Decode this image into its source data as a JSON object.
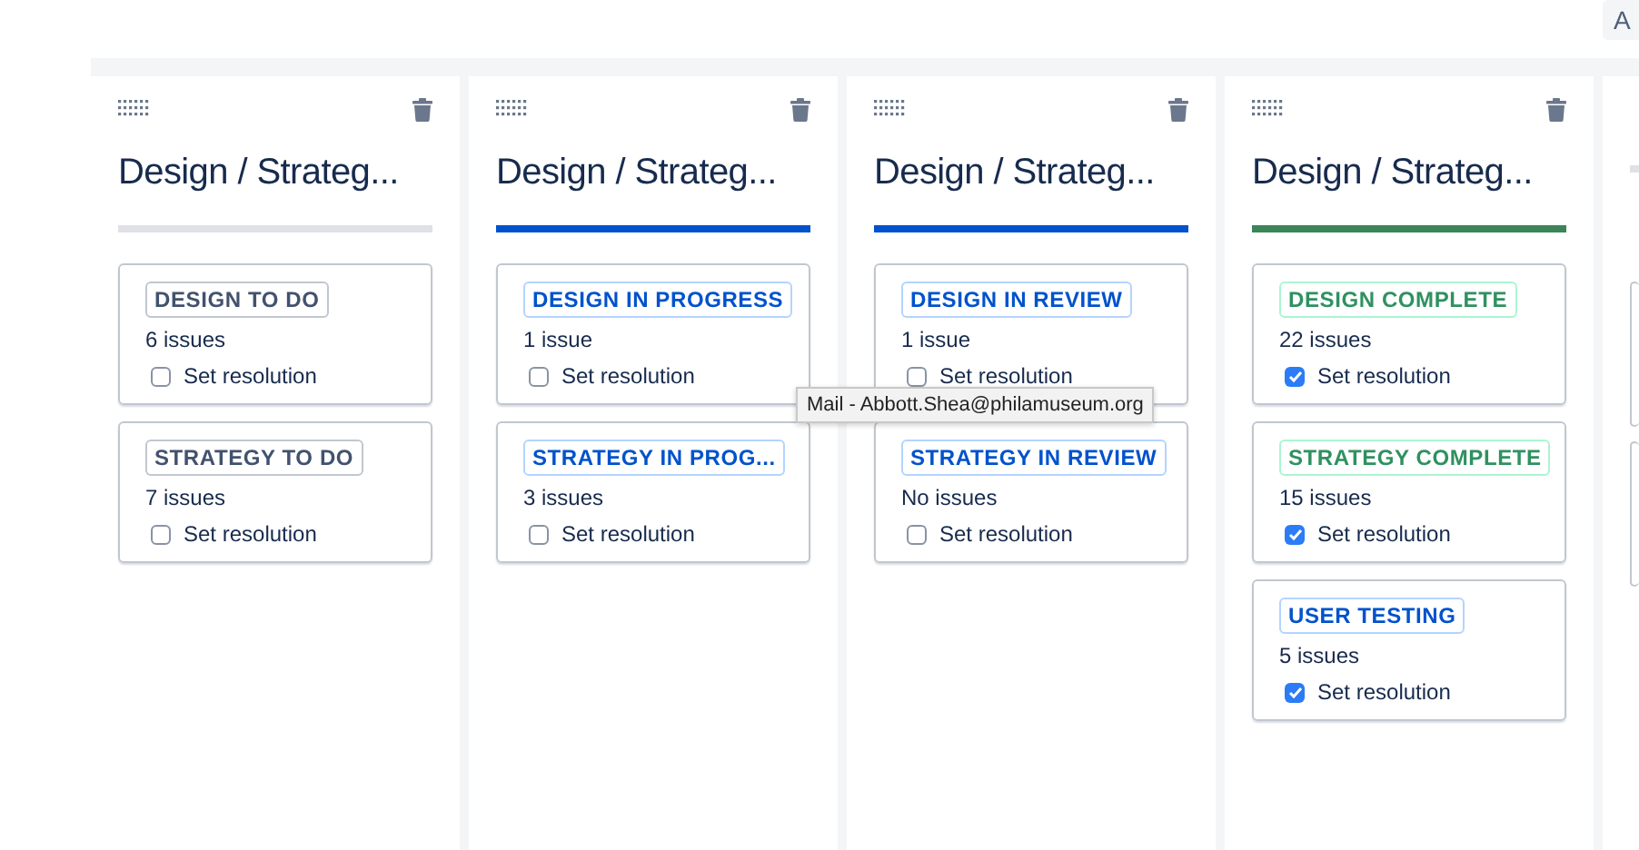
{
  "top_button": {
    "label": "A"
  },
  "columns": [
    {
      "title": "Design / Strateg...",
      "kind": "todo",
      "statuses": [
        {
          "name": "DESIGN TO DO",
          "kind": "todo",
          "count": "6 issues",
          "resolution": {
            "label": "Set resolution",
            "checked": false
          }
        },
        {
          "name": "STRATEGY TO DO",
          "kind": "todo",
          "count": "7 issues",
          "resolution": {
            "label": "Set resolution",
            "checked": false
          }
        }
      ]
    },
    {
      "title": "Design / Strateg...",
      "kind": "inprogress",
      "statuses": [
        {
          "name": "DESIGN IN PROGRESS",
          "kind": "inprogress",
          "count": "1 issue",
          "resolution": {
            "label": "Set resolution",
            "checked": false
          }
        },
        {
          "name": "STRATEGY IN PROG...",
          "kind": "inprogress",
          "count": "3 issues",
          "resolution": {
            "label": "Set resolution",
            "checked": false
          }
        }
      ]
    },
    {
      "title": "Design / Strateg...",
      "kind": "inprogress",
      "statuses": [
        {
          "name": "DESIGN IN REVIEW",
          "kind": "inprogress",
          "count": "1 issue",
          "resolution": {
            "label": "Set resolution",
            "checked": false
          }
        },
        {
          "name": "STRATEGY IN REVIEW",
          "kind": "inprogress",
          "count": "No issues",
          "resolution": {
            "label": "Set resolution",
            "checked": false
          }
        }
      ]
    },
    {
      "title": "Design / Strateg...",
      "kind": "done",
      "statuses": [
        {
          "name": "DESIGN COMPLETE",
          "kind": "done",
          "count": "22 issues",
          "resolution": {
            "label": "Set resolution",
            "checked": true
          }
        },
        {
          "name": "STRATEGY COMPLETE",
          "kind": "done",
          "count": "15 issues",
          "resolution": {
            "label": "Set resolution",
            "checked": true
          }
        },
        {
          "name": "USER TESTING",
          "kind": "inprogress",
          "count": "5 issues",
          "resolution": {
            "label": "Set resolution",
            "checked": true
          }
        }
      ]
    }
  ],
  "tooltip": {
    "text": "Mail - Abbott.Shea@philamuseum.org"
  }
}
